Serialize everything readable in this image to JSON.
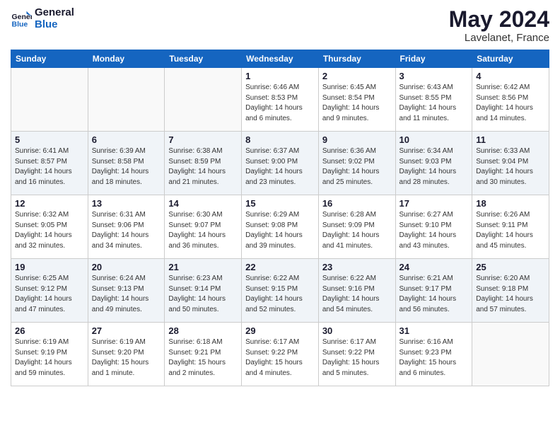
{
  "header": {
    "logo_line1": "General",
    "logo_line2": "Blue",
    "month_year": "May 2024",
    "location": "Lavelanet, France"
  },
  "weekdays": [
    "Sunday",
    "Monday",
    "Tuesday",
    "Wednesday",
    "Thursday",
    "Friday",
    "Saturday"
  ],
  "rows": [
    {
      "alt": false,
      "cells": [
        {
          "empty": true
        },
        {
          "empty": true
        },
        {
          "empty": true
        },
        {
          "day": "1",
          "info": "Sunrise: 6:46 AM\nSunset: 8:53 PM\nDaylight: 14 hours\nand 6 minutes."
        },
        {
          "day": "2",
          "info": "Sunrise: 6:45 AM\nSunset: 8:54 PM\nDaylight: 14 hours\nand 9 minutes."
        },
        {
          "day": "3",
          "info": "Sunrise: 6:43 AM\nSunset: 8:55 PM\nDaylight: 14 hours\nand 11 minutes."
        },
        {
          "day": "4",
          "info": "Sunrise: 6:42 AM\nSunset: 8:56 PM\nDaylight: 14 hours\nand 14 minutes."
        }
      ]
    },
    {
      "alt": true,
      "cells": [
        {
          "day": "5",
          "info": "Sunrise: 6:41 AM\nSunset: 8:57 PM\nDaylight: 14 hours\nand 16 minutes."
        },
        {
          "day": "6",
          "info": "Sunrise: 6:39 AM\nSunset: 8:58 PM\nDaylight: 14 hours\nand 18 minutes."
        },
        {
          "day": "7",
          "info": "Sunrise: 6:38 AM\nSunset: 8:59 PM\nDaylight: 14 hours\nand 21 minutes."
        },
        {
          "day": "8",
          "info": "Sunrise: 6:37 AM\nSunset: 9:00 PM\nDaylight: 14 hours\nand 23 minutes."
        },
        {
          "day": "9",
          "info": "Sunrise: 6:36 AM\nSunset: 9:02 PM\nDaylight: 14 hours\nand 25 minutes."
        },
        {
          "day": "10",
          "info": "Sunrise: 6:34 AM\nSunset: 9:03 PM\nDaylight: 14 hours\nand 28 minutes."
        },
        {
          "day": "11",
          "info": "Sunrise: 6:33 AM\nSunset: 9:04 PM\nDaylight: 14 hours\nand 30 minutes."
        }
      ]
    },
    {
      "alt": false,
      "cells": [
        {
          "day": "12",
          "info": "Sunrise: 6:32 AM\nSunset: 9:05 PM\nDaylight: 14 hours\nand 32 minutes."
        },
        {
          "day": "13",
          "info": "Sunrise: 6:31 AM\nSunset: 9:06 PM\nDaylight: 14 hours\nand 34 minutes."
        },
        {
          "day": "14",
          "info": "Sunrise: 6:30 AM\nSunset: 9:07 PM\nDaylight: 14 hours\nand 36 minutes."
        },
        {
          "day": "15",
          "info": "Sunrise: 6:29 AM\nSunset: 9:08 PM\nDaylight: 14 hours\nand 39 minutes."
        },
        {
          "day": "16",
          "info": "Sunrise: 6:28 AM\nSunset: 9:09 PM\nDaylight: 14 hours\nand 41 minutes."
        },
        {
          "day": "17",
          "info": "Sunrise: 6:27 AM\nSunset: 9:10 PM\nDaylight: 14 hours\nand 43 minutes."
        },
        {
          "day": "18",
          "info": "Sunrise: 6:26 AM\nSunset: 9:11 PM\nDaylight: 14 hours\nand 45 minutes."
        }
      ]
    },
    {
      "alt": true,
      "cells": [
        {
          "day": "19",
          "info": "Sunrise: 6:25 AM\nSunset: 9:12 PM\nDaylight: 14 hours\nand 47 minutes."
        },
        {
          "day": "20",
          "info": "Sunrise: 6:24 AM\nSunset: 9:13 PM\nDaylight: 14 hours\nand 49 minutes."
        },
        {
          "day": "21",
          "info": "Sunrise: 6:23 AM\nSunset: 9:14 PM\nDaylight: 14 hours\nand 50 minutes."
        },
        {
          "day": "22",
          "info": "Sunrise: 6:22 AM\nSunset: 9:15 PM\nDaylight: 14 hours\nand 52 minutes."
        },
        {
          "day": "23",
          "info": "Sunrise: 6:22 AM\nSunset: 9:16 PM\nDaylight: 14 hours\nand 54 minutes."
        },
        {
          "day": "24",
          "info": "Sunrise: 6:21 AM\nSunset: 9:17 PM\nDaylight: 14 hours\nand 56 minutes."
        },
        {
          "day": "25",
          "info": "Sunrise: 6:20 AM\nSunset: 9:18 PM\nDaylight: 14 hours\nand 57 minutes."
        }
      ]
    },
    {
      "alt": false,
      "cells": [
        {
          "day": "26",
          "info": "Sunrise: 6:19 AM\nSunset: 9:19 PM\nDaylight: 14 hours\nand 59 minutes."
        },
        {
          "day": "27",
          "info": "Sunrise: 6:19 AM\nSunset: 9:20 PM\nDaylight: 15 hours\nand 1 minute."
        },
        {
          "day": "28",
          "info": "Sunrise: 6:18 AM\nSunset: 9:21 PM\nDaylight: 15 hours\nand 2 minutes."
        },
        {
          "day": "29",
          "info": "Sunrise: 6:17 AM\nSunset: 9:22 PM\nDaylight: 15 hours\nand 4 minutes."
        },
        {
          "day": "30",
          "info": "Sunrise: 6:17 AM\nSunset: 9:22 PM\nDaylight: 15 hours\nand 5 minutes."
        },
        {
          "day": "31",
          "info": "Sunrise: 6:16 AM\nSunset: 9:23 PM\nDaylight: 15 hours\nand 6 minutes."
        },
        {
          "empty": true
        }
      ]
    }
  ]
}
